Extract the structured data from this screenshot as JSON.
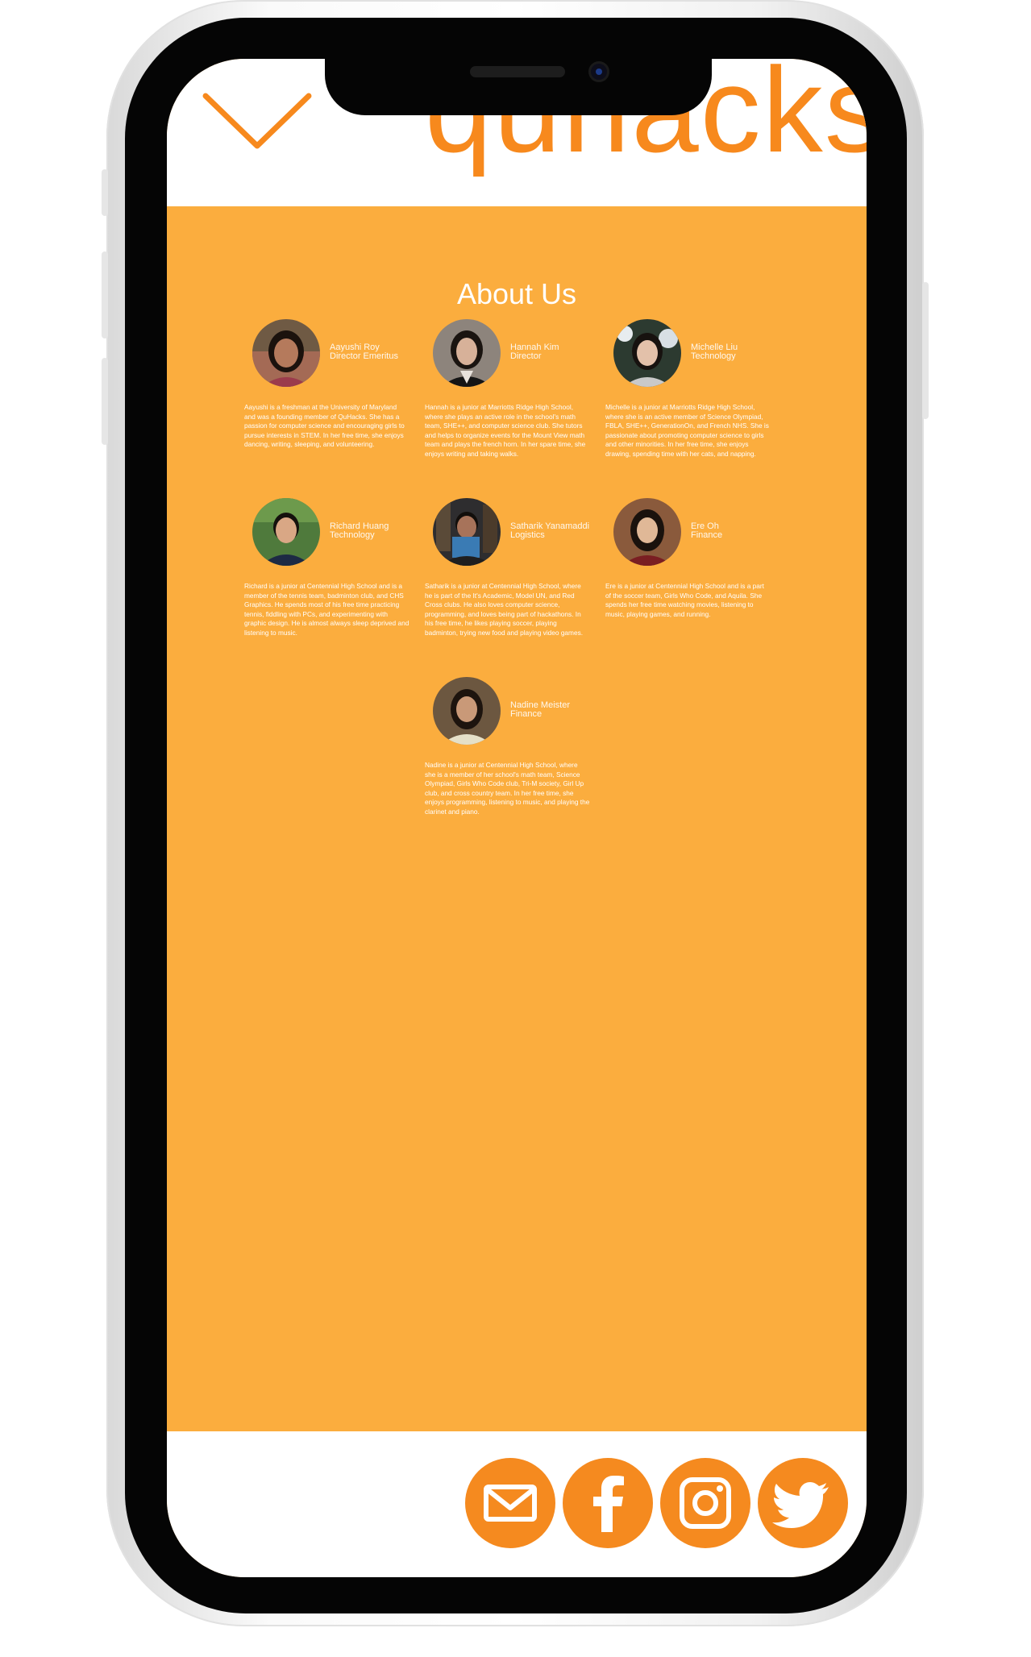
{
  "header": {
    "logo_text": "quhacks",
    "menu_icon": "chevron-down-icon"
  },
  "about": {
    "title": "About Us",
    "members": [
      {
        "name": "Aayushi Roy",
        "role": "Director Emeritus",
        "bio": "Aayushi is a freshman at the University of Maryland and was a founding member of QuHacks. She has a passion for computer science and encouraging girls to pursue interests in STEM. In her free time, she enjoys dancing, writing, sleeping, and volunteering."
      },
      {
        "name": "Hannah Kim",
        "role": "Director",
        "bio": "Hannah is a junior at Marriotts Ridge High School, where she plays an active role in the school's math team, SHE++, and computer science club. She tutors and helps to organize events for the Mount View math team and plays the french horn. In her spare time, she enjoys writing and taking walks."
      },
      {
        "name": "Michelle Liu",
        "role": "Technology",
        "bio": "Michelle is a junior at Marriotts Ridge High School, where she is an active member of Science Olympiad, FBLA, SHE++, GenerationOn, and French NHS. She is passionate about promoting computer science to girls and other minorities. In her free time, she enjoys drawing, spending time with her cats, and napping."
      },
      {
        "name": "Richard Huang",
        "role": "Technology",
        "bio": "Richard is a junior at Centennial High School and is a member of the tennis team, badminton club, and CHS Graphics. He spends most of his free time practicing tennis, fiddling with PCs, and experimenting with graphic design. He is almost always sleep deprived and listening to music."
      },
      {
        "name": "Satharik Yanamaddi",
        "role": "Logistics",
        "bio": "Satharik is a junior at Centennial High School, where he is part of the It's Academic, Model UN, and Red Cross clubs. He also loves computer science, programming, and loves being part of hackathons. In his free time, he likes playing soccer, playing badminton, trying new food and playing video games."
      },
      {
        "name": "Ere Oh",
        "role": "Finance",
        "bio": "Ere is a junior at Centennial High School and is a part of the soccer team, Girls Who Code, and Aquila. She spends her free time watching movies, listening to music, playing games, and running."
      },
      {
        "name": "Nadine Meister",
        "role": "Finance",
        "bio": "Nadine is a junior at Centennial High School, where she is a member of her school's math team, Science Olympiad, Girls Who Code club, Tri-M society, Girl Up club, and cross country team. In her free time, she enjoys programming, listening to music, and playing the clarinet and piano."
      }
    ]
  },
  "footer": {
    "social": [
      {
        "name": "mail-icon"
      },
      {
        "name": "facebook-icon"
      },
      {
        "name": "instagram-icon"
      },
      {
        "name": "twitter-icon"
      }
    ]
  },
  "colors": {
    "accent": "#f58a1f",
    "background": "#fbad3e",
    "logo": "#f7891d"
  }
}
